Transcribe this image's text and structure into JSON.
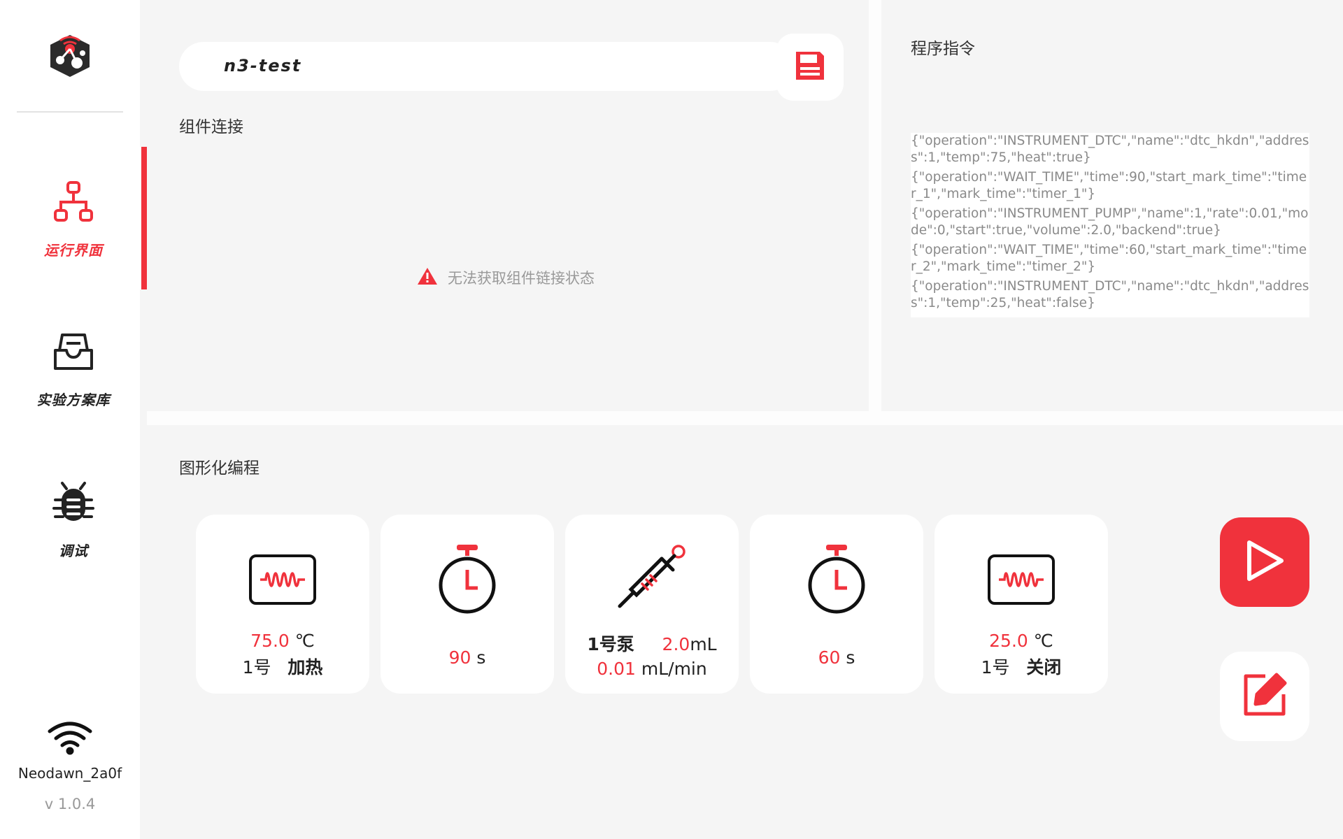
{
  "sidebar": {
    "logo_icon": "robot-logo-icon",
    "items": [
      {
        "label": "运行界面",
        "icon": "hierarchy-icon",
        "active": true
      },
      {
        "label": "实验方案库",
        "icon": "inbox-tray-icon",
        "active": false
      },
      {
        "label": "调试",
        "icon": "bug-icon",
        "active": false
      }
    ],
    "wifi_name": "Neodawn_2a0f",
    "version": "v 1.0.4"
  },
  "connect": {
    "program_name": "n3-test",
    "section_title": "组件连接",
    "warning_text": "无法获取组件链接状态"
  },
  "program": {
    "section_title": "程序指令",
    "commands": [
      "{\"operation\":\"INSTRUMENT_DTC\",\"name\":\"dtc_hkdn\",\"address\":1,\"temp\":75,\"heat\":true}",
      "{\"operation\":\"WAIT_TIME\",\"time\":90,\"start_mark_time\":\"timer_1\",\"mark_time\":\"timer_1\"}",
      "{\"operation\":\"INSTRUMENT_PUMP\",\"name\":1,\"rate\":0.01,\"mode\":0,\"start\":true,\"volume\":2.0,\"backend\":true}",
      "{\"operation\":\"WAIT_TIME\",\"time\":60,\"start_mark_time\":\"timer_2\",\"mark_time\":\"timer_2\"}",
      "{\"operation\":\"INSTRUMENT_DTC\",\"name\":\"dtc_hkdn\",\"address\":1,\"temp\":25,\"heat\":false}"
    ]
  },
  "graph": {
    "section_title": "图形化编程",
    "cards": [
      {
        "type": "heater",
        "value": "75.0",
        "unit": "℃",
        "id": "1号",
        "action": "加热"
      },
      {
        "type": "timer",
        "value": "90",
        "unit": "s"
      },
      {
        "type": "pump",
        "id": "1号泵",
        "volume": "2.0",
        "volume_unit": "mL",
        "rate": "0.01",
        "rate_unit": "mL/min"
      },
      {
        "type": "timer",
        "value": "60",
        "unit": "s"
      },
      {
        "type": "heater",
        "value": "25.0",
        "unit": "℃",
        "id": "1号",
        "action": "关闭"
      }
    ]
  },
  "colors": {
    "accent": "#f0323c",
    "background": "#f5f5f5",
    "panel": "#ffffff",
    "muted_text": "#999999"
  }
}
